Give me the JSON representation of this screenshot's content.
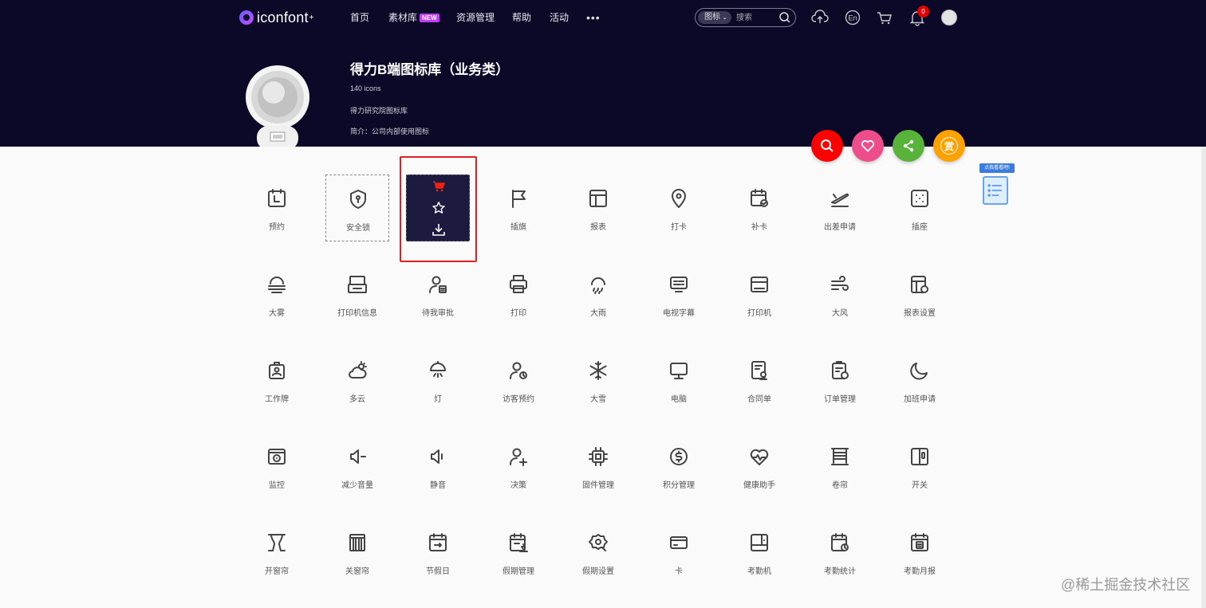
{
  "nav": {
    "logo_text": "iconfont",
    "logo_sup": "+",
    "items": [
      "首页",
      "素材库",
      "资源管理",
      "帮助",
      "活动"
    ],
    "new_badge": "NEW",
    "more": "•••",
    "search_type": "图标",
    "search_placeholder": "搜索",
    "notification_count": "0"
  },
  "library": {
    "title": "得力B端图标库（业务类）",
    "count": "140 icons",
    "author": "得力研究院图标库",
    "desc": "简介：公司内部使用图标"
  },
  "actions": {
    "reward_label": "赏"
  },
  "side_widget": {
    "tag": "点我看看吧!"
  },
  "icons": [
    "预约",
    "安全锁",
    "",
    "插旗",
    "报表",
    "打卡",
    "补卡",
    "出差申请",
    "插座",
    "大雾",
    "打印机信息",
    "待我审批",
    "打印",
    "大雨",
    "电视字幕",
    "打印机",
    "大风",
    "报表设置",
    "工作牌",
    "多云",
    "灯",
    "访客预约",
    "大雪",
    "电脑",
    "合同单",
    "订单管理",
    "加班申请",
    "监控",
    "减少音量",
    "静音",
    "决策",
    "固件管理",
    "积分管理",
    "健康助手",
    "卷帘",
    "开关",
    "开窗帘",
    "关窗帘",
    "节假日",
    "假期管理",
    "假期设置",
    "卡",
    "考勤机",
    "考勤统计",
    "考勤月报"
  ],
  "watermark": "@稀土掘金技术社区",
  "colors": {
    "banner": "#0b0828",
    "search_btn": "#ff0000",
    "favorite_btn": "#ee4d8c",
    "share_btn": "#59b33b",
    "reward_btn": "#ffa200",
    "highlight": "#e02020"
  }
}
